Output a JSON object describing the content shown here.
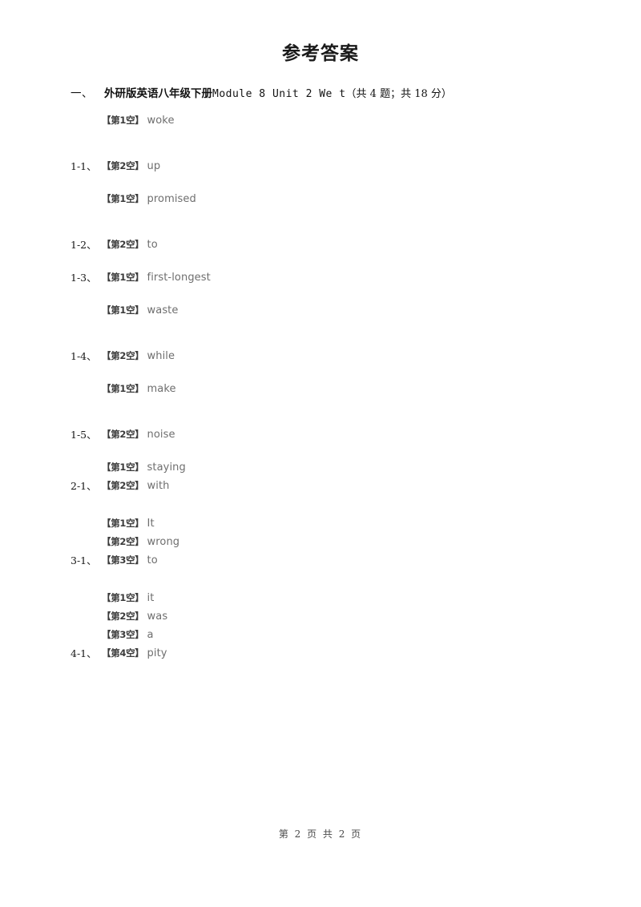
{
  "document": {
    "title": "参考答案",
    "footer": "第 2 页 共 2 页"
  },
  "section": {
    "number": "一、",
    "title_cjk": "外研版英语八年级下册",
    "title_latin": "Module 8 Unit 2 We t",
    "score_note": "（共 4 题；共 18 分）"
  },
  "answers": [
    {
      "number": "1-1、",
      "spacing": "wide",
      "blanks": [
        {
          "label": "【第1空】",
          "answer": "woke"
        },
        {
          "label": "【第2空】",
          "answer": "up"
        }
      ]
    },
    {
      "number": "1-2、",
      "spacing": "wide",
      "blanks": [
        {
          "label": "【第1空】",
          "answer": "promised"
        },
        {
          "label": "【第2空】",
          "answer": "to"
        }
      ]
    },
    {
      "number": "1-3、",
      "spacing": "wide",
      "blanks": [
        {
          "label": "【第1空】",
          "answer": "first-longest"
        }
      ]
    },
    {
      "number": "1-4、",
      "spacing": "wide",
      "blanks": [
        {
          "label": "【第1空】",
          "answer": "waste"
        },
        {
          "label": "【第2空】",
          "answer": "while"
        }
      ]
    },
    {
      "number": "1-5、",
      "spacing": "wide",
      "blanks": [
        {
          "label": "【第1空】",
          "answer": "make"
        },
        {
          "label": "【第2空】",
          "answer": "noise"
        }
      ]
    },
    {
      "number": "2-1、",
      "spacing": "tight",
      "blanks": [
        {
          "label": "【第1空】",
          "answer": "staying"
        },
        {
          "label": "【第2空】",
          "answer": "with"
        }
      ]
    },
    {
      "number": "3-1、",
      "spacing": "tight",
      "blanks": [
        {
          "label": "【第1空】",
          "answer": "It"
        },
        {
          "label": "【第2空】",
          "answer": "wrong"
        },
        {
          "label": "【第3空】",
          "answer": "to"
        }
      ]
    },
    {
      "number": "4-1、",
      "spacing": "tight",
      "blanks": [
        {
          "label": "【第1空】",
          "answer": "it"
        },
        {
          "label": "【第2空】",
          "answer": "was"
        },
        {
          "label": "【第3空】",
          "answer": "a"
        },
        {
          "label": "【第4空】",
          "answer": "pity"
        }
      ]
    }
  ]
}
